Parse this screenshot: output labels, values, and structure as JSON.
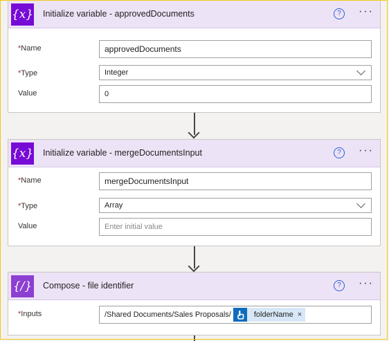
{
  "cards": [
    {
      "title": "Initialize variable - approvedDocuments",
      "icon": "variable-icon",
      "icon_glyph": "{x}",
      "fields": {
        "name_label": "Name",
        "name_value": "approvedDocuments",
        "type_label": "Type",
        "type_value": "Integer",
        "value_label": "Value",
        "value_value": "0"
      }
    },
    {
      "title": "Initialize variable - mergeDocumentsInput",
      "icon": "variable-icon",
      "icon_glyph": "{x}",
      "fields": {
        "name_label": "Name",
        "name_value": "mergeDocumentsInput",
        "type_label": "Type",
        "type_value": "Array",
        "value_label": "Value",
        "value_placeholder": "Enter initial value"
      }
    },
    {
      "title": "Compose - file identifier",
      "icon": "compose-icon",
      "icon_glyph": "{∕}",
      "fields": {
        "inputs_label": "Inputs",
        "inputs_text": "/Shared Documents/Sales Proposals/",
        "token_label": "folderName",
        "token_icon": "touch-icon",
        "token_close": "×"
      }
    }
  ],
  "required_marker": "*",
  "help_glyph": "?",
  "more_glyph": "···",
  "colors": {
    "variable_icon_bg": "#770bd6",
    "compose_icon_bg": "#8c3fd1",
    "header_bg": "#ede3f6",
    "token_bg": "#d8e7f7",
    "token_icon_bg": "#0f6cbd",
    "frame_border": "#f2c811"
  }
}
